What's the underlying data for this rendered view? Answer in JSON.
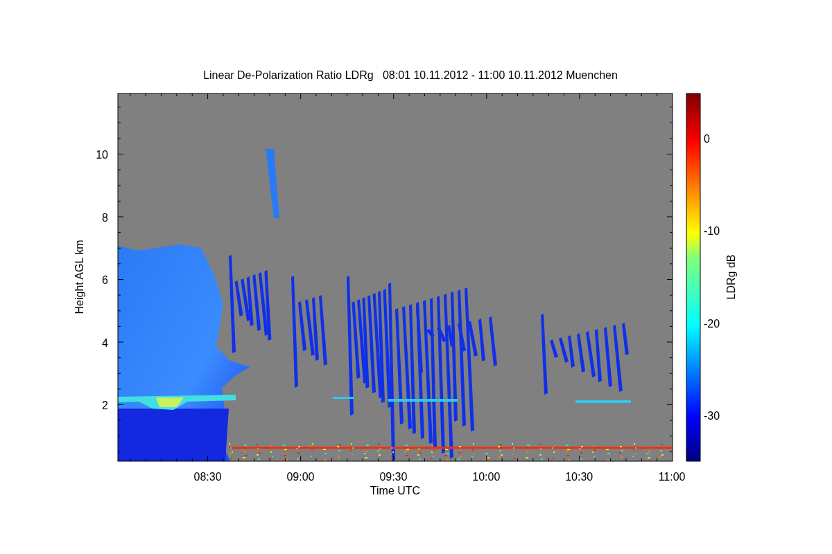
{
  "title": "Linear De-Polarization Ratio LDRg   08:01 10.11.2012 - 11:00 10.11.2012 Muenchen",
  "y_axis": {
    "label": "Height AGL km",
    "ticks": [
      "10",
      "8",
      "6",
      "4",
      "2"
    ]
  },
  "x_axis": {
    "label": "Time UTC",
    "ticks": [
      "08:30",
      "09:00",
      "09:30",
      "10:00",
      "10:30",
      "11:00"
    ]
  },
  "colorbar": {
    "label": "LDRg dB",
    "ticks": [
      "0",
      "-10",
      "-20",
      "-30"
    ]
  }
}
